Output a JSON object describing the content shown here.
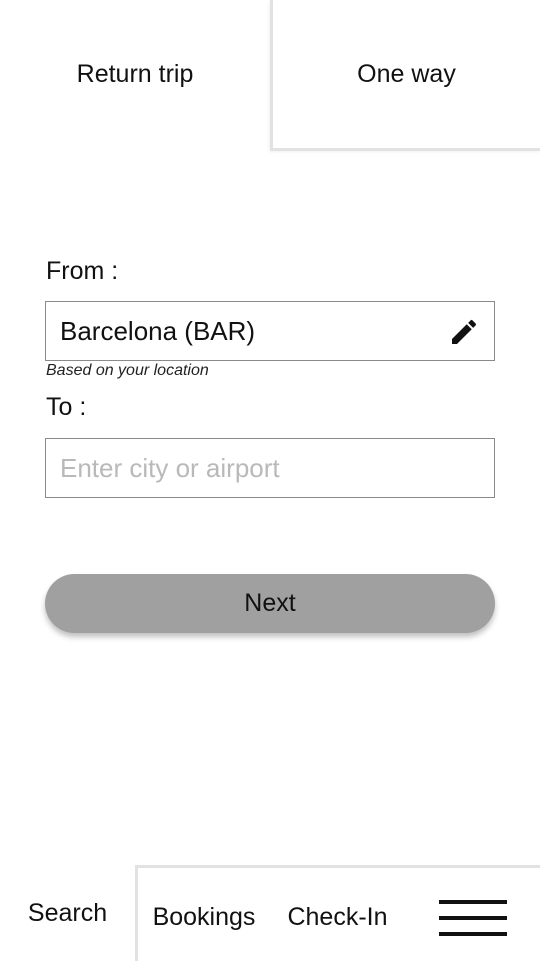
{
  "trip_tabs": {
    "return_trip": "Return trip",
    "one_way": "One way"
  },
  "from": {
    "label": "From :",
    "value": "Barcelona (BAR)",
    "hint": "Based on your location",
    "edit_icon": "pencil-icon"
  },
  "to": {
    "label": "To :",
    "value": "",
    "placeholder": "Enter city or airport"
  },
  "next_button": "Next",
  "bottom_nav": {
    "search": "Search",
    "bookings": "Bookings",
    "checkin": "Check-In",
    "menu_icon": "hamburger-menu-icon"
  },
  "colors": {
    "button_bg": "#a0a0a0",
    "border": "#8a8a8a",
    "divider": "#e2e2e2",
    "placeholder": "#b9b9b9"
  }
}
